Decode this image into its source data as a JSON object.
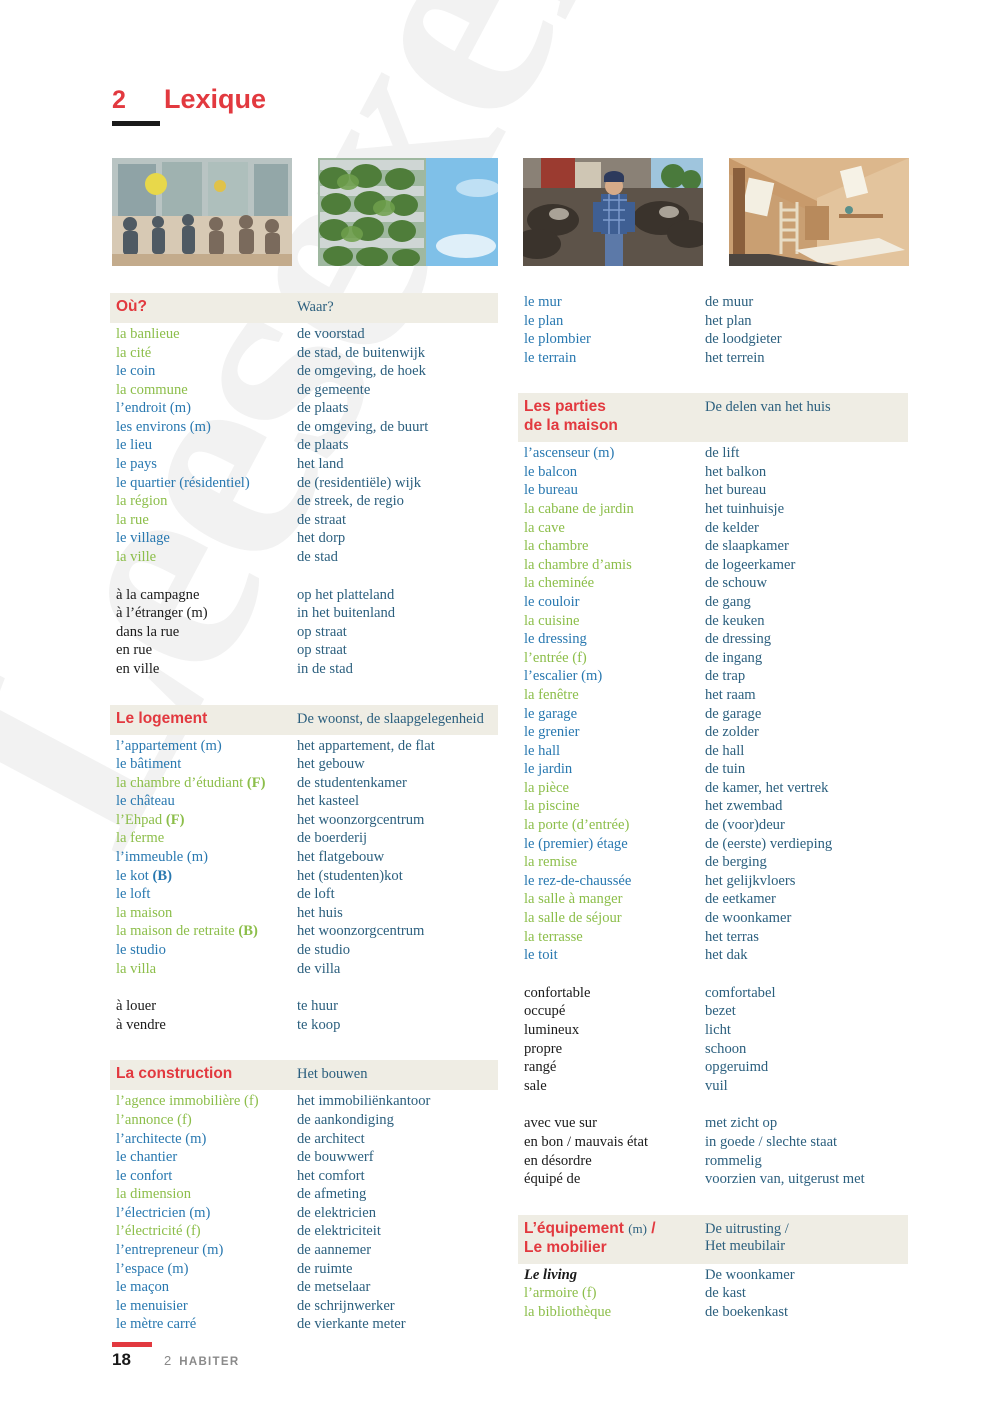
{
  "watermark": {
    "text": "Leesexemplaar"
  },
  "header": {
    "chapter_number": "2",
    "title": "Lexique"
  },
  "colors": {
    "accent_red": "#e2393f",
    "feminine_green": "#8cbe4a",
    "masculine_blue": "#2878b0",
    "dutch_blue": "#2b5f7e",
    "header_band": "#efede4"
  },
  "photos": [
    {
      "name": "photo-cafeteria-common-room",
      "alt": "people seated in a bright common room with large windows"
    },
    {
      "name": "photo-vertical-garden-building",
      "alt": "high-rise building facade covered with planted balconies"
    },
    {
      "name": "photo-farmer-with-cattle",
      "alt": "farmer in a checked shirt standing in a barn with cows"
    },
    {
      "name": "photo-attic-bedroom",
      "alt": "wooden attic room with a mattress and skylight"
    }
  ],
  "footer": {
    "page_number": "18",
    "chapter_number": "2",
    "chapter_label": "HABITER"
  },
  "left_column": [
    {
      "id": "ou",
      "header": {
        "fr": "Où?",
        "nl": "Waar?"
      },
      "rows": [
        {
          "fr": "la banlieue",
          "nl": "de voorstad",
          "g": "fem"
        },
        {
          "fr": "la cité",
          "nl": "de stad, de buitenwijk",
          "g": "fem"
        },
        {
          "fr": "le coin",
          "nl": "de omgeving, de hoek",
          "g": "masc"
        },
        {
          "fr": "la commune",
          "nl": "de gemeente",
          "g": "fem"
        },
        {
          "fr": "l’endroit (m)",
          "nl": "de plaats",
          "g": "masc"
        },
        {
          "fr": "les environs (m)",
          "nl": "de omgeving, de buurt",
          "g": "masc"
        },
        {
          "fr": "le lieu",
          "nl": "de plaats",
          "g": "masc"
        },
        {
          "fr": "le pays",
          "nl": "het land",
          "g": "masc"
        },
        {
          "fr": "le quartier (résidentiel)",
          "nl": "de (residentiële) wijk",
          "g": "masc"
        },
        {
          "fr": "la région",
          "nl": "de streek, de regio",
          "g": "fem"
        },
        {
          "fr": "la rue",
          "nl": "de straat",
          "g": "fem"
        },
        {
          "fr": "le village",
          "nl": "het dorp",
          "g": "masc"
        },
        {
          "fr": "la ville",
          "nl": "de stad",
          "g": "fem"
        },
        {
          "gap": true
        },
        {
          "fr": "à la campagne",
          "nl": "op het platteland",
          "g": "neu"
        },
        {
          "fr": "à l’étranger (m)",
          "nl": "in het buitenland",
          "g": "neu"
        },
        {
          "fr": "dans la rue",
          "nl": "op straat",
          "g": "neu"
        },
        {
          "fr": "en rue",
          "nl": "op straat",
          "g": "neu"
        },
        {
          "fr": "en ville",
          "nl": "in de stad",
          "g": "neu"
        }
      ]
    },
    {
      "id": "le-logement",
      "header": {
        "fr": "Le logement",
        "nl": "De woonst, de slaapgelegenheid"
      },
      "rows": [
        {
          "fr": "l’appartement (m)",
          "nl": "het appartement, de flat",
          "g": "masc"
        },
        {
          "fr": "le bâtiment",
          "nl": "het gebouw",
          "g": "masc"
        },
        {
          "fr": "la chambre d’étudiant (F)",
          "nl": "de studentenkamer",
          "g": "fem",
          "mark": "F"
        },
        {
          "fr": "le château",
          "nl": "het kasteel",
          "g": "masc"
        },
        {
          "fr": "l’Ehpad (F)",
          "nl": "het woonzorgcentrum",
          "g": "fem",
          "mark": "F"
        },
        {
          "fr": "la ferme",
          "nl": "de boerderij",
          "g": "fem"
        },
        {
          "fr": "l’immeuble (m)",
          "nl": "het flatgebouw",
          "g": "masc"
        },
        {
          "fr": "le kot (B)",
          "nl": "het (studenten)kot",
          "g": "masc",
          "mark": "B"
        },
        {
          "fr": "le loft",
          "nl": "de loft",
          "g": "masc"
        },
        {
          "fr": "la maison",
          "nl": "het huis",
          "g": "fem"
        },
        {
          "fr": "la maison de retraite (B)",
          "nl": "het woonzorgcentrum",
          "g": "fem",
          "mark": "B"
        },
        {
          "fr": "le studio",
          "nl": "de studio",
          "g": "masc"
        },
        {
          "fr": "la villa",
          "nl": "de villa",
          "g": "fem"
        },
        {
          "gap": true
        },
        {
          "fr": "à louer",
          "nl": "te huur",
          "g": "neu"
        },
        {
          "fr": "à vendre",
          "nl": "te koop",
          "g": "neu"
        }
      ]
    },
    {
      "id": "la-construction",
      "header": {
        "fr": "La construction",
        "nl": "Het bouwen"
      },
      "rows": [
        {
          "fr": "l’agence immobilière (f)",
          "nl": "het immobiliënkantoor",
          "g": "fem"
        },
        {
          "fr": "l’annonce (f)",
          "nl": "de aankondiging",
          "g": "fem"
        },
        {
          "fr": "l’architecte (m)",
          "nl": "de architect",
          "g": "masc"
        },
        {
          "fr": "le chantier",
          "nl": "de bouwwerf",
          "g": "masc"
        },
        {
          "fr": "le confort",
          "nl": "het comfort",
          "g": "masc"
        },
        {
          "fr": "la dimension",
          "nl": "de afmeting",
          "g": "fem"
        },
        {
          "fr": "l’électricien (m)",
          "nl": "de elektricien",
          "g": "masc"
        },
        {
          "fr": "l’électricité (f)",
          "nl": "de elektriciteit",
          "g": "fem"
        },
        {
          "fr": "l’entrepreneur (m)",
          "nl": "de aannemer",
          "g": "masc"
        },
        {
          "fr": "l’espace (m)",
          "nl": "de ruimte",
          "g": "masc"
        },
        {
          "fr": "le maçon",
          "nl": "de metselaar",
          "g": "masc"
        },
        {
          "fr": "le menuisier",
          "nl": "de schrijnwerker",
          "g": "masc"
        },
        {
          "fr": "le mètre carré",
          "nl": "de vierkante meter",
          "g": "masc"
        }
      ]
    }
  ],
  "right_column": [
    {
      "id": "construction-continued",
      "header": null,
      "rows": [
        {
          "fr": "le mur",
          "nl": "de muur",
          "g": "masc"
        },
        {
          "fr": "le plan",
          "nl": "het plan",
          "g": "masc"
        },
        {
          "fr": "le plombier",
          "nl": "de loodgieter",
          "g": "masc"
        },
        {
          "fr": "le terrain",
          "nl": "het terrein",
          "g": "masc"
        }
      ]
    },
    {
      "id": "les-parties-de-la-maison",
      "header": {
        "fr": "Les parties\nde la maison",
        "nl": "De delen van het huis"
      },
      "rows": [
        {
          "fr": "l’ascenseur (m)",
          "nl": "de lift",
          "g": "masc"
        },
        {
          "fr": "le balcon",
          "nl": "het balkon",
          "g": "masc"
        },
        {
          "fr": "le bureau",
          "nl": "het bureau",
          "g": "masc"
        },
        {
          "fr": "la cabane de jardin",
          "nl": "het tuinhuisje",
          "g": "fem"
        },
        {
          "fr": "la cave",
          "nl": "de kelder",
          "g": "fem"
        },
        {
          "fr": "la chambre",
          "nl": "de slaapkamer",
          "g": "fem"
        },
        {
          "fr": "la chambre d’amis",
          "nl": "de logeerkamer",
          "g": "fem"
        },
        {
          "fr": "la cheminée",
          "nl": "de schouw",
          "g": "fem"
        },
        {
          "fr": "le couloir",
          "nl": "de gang",
          "g": "masc"
        },
        {
          "fr": "la cuisine",
          "nl": "de keuken",
          "g": "fem"
        },
        {
          "fr": "le dressing",
          "nl": "de dressing",
          "g": "masc"
        },
        {
          "fr": "l’entrée (f)",
          "nl": "de ingang",
          "g": "fem"
        },
        {
          "fr": "l’escalier (m)",
          "nl": "de trap",
          "g": "masc"
        },
        {
          "fr": "la fenêtre",
          "nl": "het raam",
          "g": "fem"
        },
        {
          "fr": "le garage",
          "nl": "de garage",
          "g": "masc"
        },
        {
          "fr": "le grenier",
          "nl": "de zolder",
          "g": "masc"
        },
        {
          "fr": "le hall",
          "nl": "de hall",
          "g": "masc"
        },
        {
          "fr": "le jardin",
          "nl": "de tuin",
          "g": "masc"
        },
        {
          "fr": "la pièce",
          "nl": "de kamer, het vertrek",
          "g": "fem"
        },
        {
          "fr": "la piscine",
          "nl": "het zwembad",
          "g": "fem"
        },
        {
          "fr": "la porte (d’entrée)",
          "nl": "de (voor)deur",
          "g": "fem"
        },
        {
          "fr": "le (premier) étage",
          "nl": "de (eerste) verdieping",
          "g": "masc"
        },
        {
          "fr": "la remise",
          "nl": "de berging",
          "g": "fem"
        },
        {
          "fr": "le rez-de-chaussée",
          "nl": "het gelijkvloers",
          "g": "masc"
        },
        {
          "fr": "la salle à manger",
          "nl": "de eetkamer",
          "g": "fem"
        },
        {
          "fr": "la salle de séjour",
          "nl": "de woonkamer",
          "g": "fem"
        },
        {
          "fr": "la terrasse",
          "nl": "het terras",
          "g": "fem"
        },
        {
          "fr": "le toit",
          "nl": "het dak",
          "g": "masc"
        },
        {
          "gap": true
        },
        {
          "fr": "confortable",
          "nl": "comfortabel",
          "g": "neu"
        },
        {
          "fr": "occupé",
          "nl": "bezet",
          "g": "neu"
        },
        {
          "fr": "lumineux",
          "nl": "licht",
          "g": "neu"
        },
        {
          "fr": "propre",
          "nl": "schoon",
          "g": "neu"
        },
        {
          "fr": "rangé",
          "nl": "opgeruimd",
          "g": "neu"
        },
        {
          "fr": "sale",
          "nl": "vuil",
          "g": "neu"
        },
        {
          "gap": true
        },
        {
          "fr": "avec vue sur",
          "nl": "met zicht op",
          "g": "neu"
        },
        {
          "fr": "en bon / mauvais état",
          "nl": "in goede / slechte staat",
          "g": "neu"
        },
        {
          "fr": "en désordre",
          "nl": "rommelig",
          "g": "neu"
        },
        {
          "fr": "équipé de",
          "nl": "voorzien van, uitgerust met",
          "g": "neu"
        }
      ]
    },
    {
      "id": "lequipement-le-mobilier",
      "header": {
        "fr": "L’équipement (m) /\nLe mobilier",
        "nl": "De uitrusting /\nHet meubilair",
        "gender_inline": "(m)"
      },
      "rows": [
        {
          "fr": "Le living",
          "nl": "De woonkamer",
          "g": "sub"
        },
        {
          "fr": "l’armoire (f)",
          "nl": "de kast",
          "g": "fem"
        },
        {
          "fr": "la bibliothèque",
          "nl": "de boekenkast",
          "g": "fem"
        }
      ]
    }
  ]
}
